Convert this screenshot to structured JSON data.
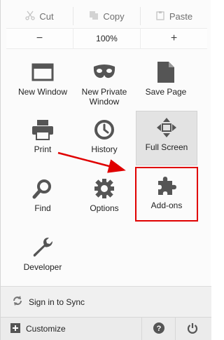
{
  "edit": {
    "cut_label": "Cut",
    "copy_label": "Copy",
    "paste_label": "Paste"
  },
  "zoom": {
    "minus_label": "−",
    "value": "100%",
    "plus_label": "+"
  },
  "tiles": [
    {
      "label": "New Window",
      "icon": "window-icon"
    },
    {
      "label": "New Private\nWindow",
      "icon": "mask-icon"
    },
    {
      "label": "Save Page",
      "icon": "page-icon"
    },
    {
      "label": "Print",
      "icon": "printer-icon"
    },
    {
      "label": "History",
      "icon": "clock-icon"
    },
    {
      "label": "Full Screen",
      "icon": "fullscreen-icon"
    },
    {
      "label": "Find",
      "icon": "magnifier-icon"
    },
    {
      "label": "Options",
      "icon": "gear-icon"
    },
    {
      "label": "Add-ons",
      "icon": "puzzle-icon"
    },
    {
      "label": "Developer",
      "icon": "wrench-icon"
    }
  ],
  "footer": {
    "sync_label": "Sign in to Sync",
    "customize_label": "Customize"
  },
  "colors": {
    "highlight": "#e00000",
    "icon": "#555555"
  }
}
